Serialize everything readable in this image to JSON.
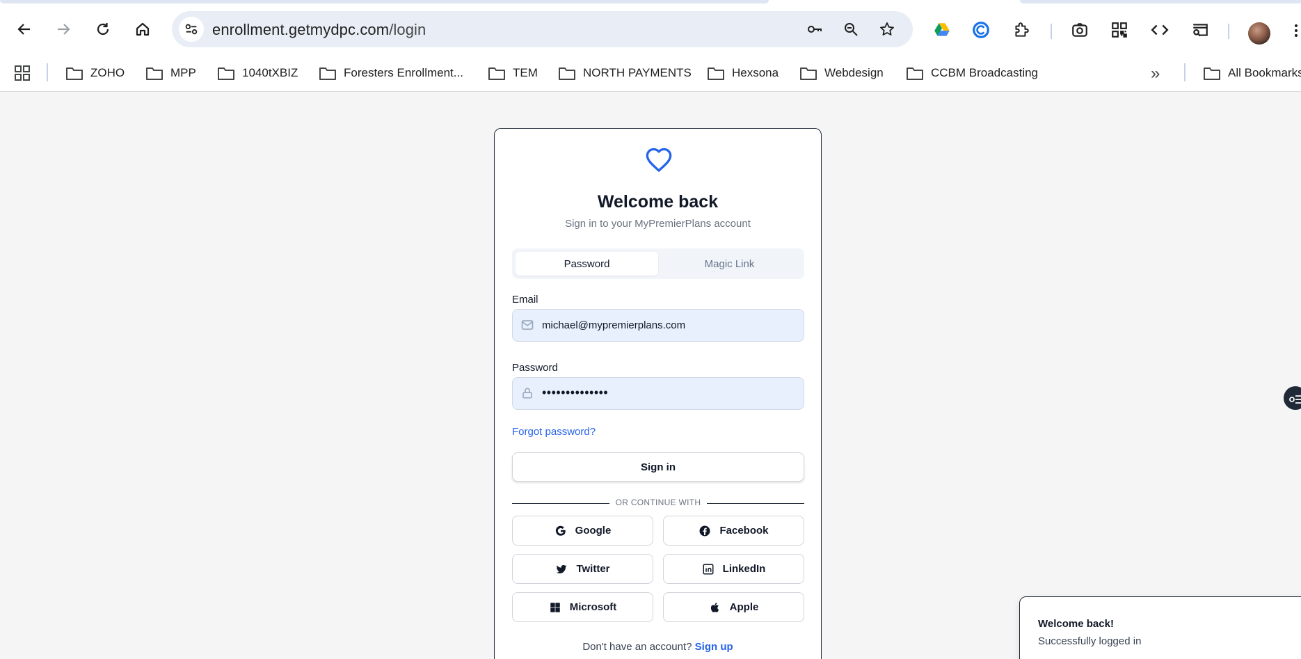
{
  "browser": {
    "url_host": "enrollment.getmydpc.com",
    "url_path": "/login",
    "bookmarks": [
      {
        "label": "ZOHO"
      },
      {
        "label": "MPP"
      },
      {
        "label": "1040tXBIZ"
      },
      {
        "label": "Foresters Enrollment..."
      },
      {
        "label": "TEM"
      },
      {
        "label": "NORTH PAYMENTS"
      },
      {
        "label": "Hexsona"
      },
      {
        "label": "Webdesign"
      },
      {
        "label": "CCBM Broadcasting"
      }
    ],
    "more_bookmarks": "»",
    "all_bookmarks": "All Bookmarks"
  },
  "login": {
    "title": "Welcome back",
    "subtitle": "Sign in to your MyPremierPlans account",
    "tabs": [
      {
        "label": "Password",
        "active": true
      },
      {
        "label": "Magic Link",
        "active": false
      }
    ],
    "email_label": "Email",
    "email_value": "michael@mypremierplans.com",
    "password_label": "Password",
    "password_value": "••••••••••••••",
    "forgot_link": "Forgot password?",
    "signin_button": "Sign in",
    "divider_text": "OR CONTINUE WITH",
    "social": [
      {
        "label": "Google",
        "icon": "google-icon"
      },
      {
        "label": "Facebook",
        "icon": "facebook-icon"
      },
      {
        "label": "Twitter",
        "icon": "twitter-icon"
      },
      {
        "label": "LinkedIn",
        "icon": "linkedin-icon"
      },
      {
        "label": "Microsoft",
        "icon": "microsoft-icon"
      },
      {
        "label": "Apple",
        "icon": "apple-icon"
      }
    ],
    "signup_prompt": "Don't have an account?",
    "signup_link": "Sign up",
    "accent_color": "#2563eb",
    "field_bg": "#e8f0fe"
  },
  "toast": {
    "title": "Welcome back!",
    "description": "Successfully logged in"
  }
}
